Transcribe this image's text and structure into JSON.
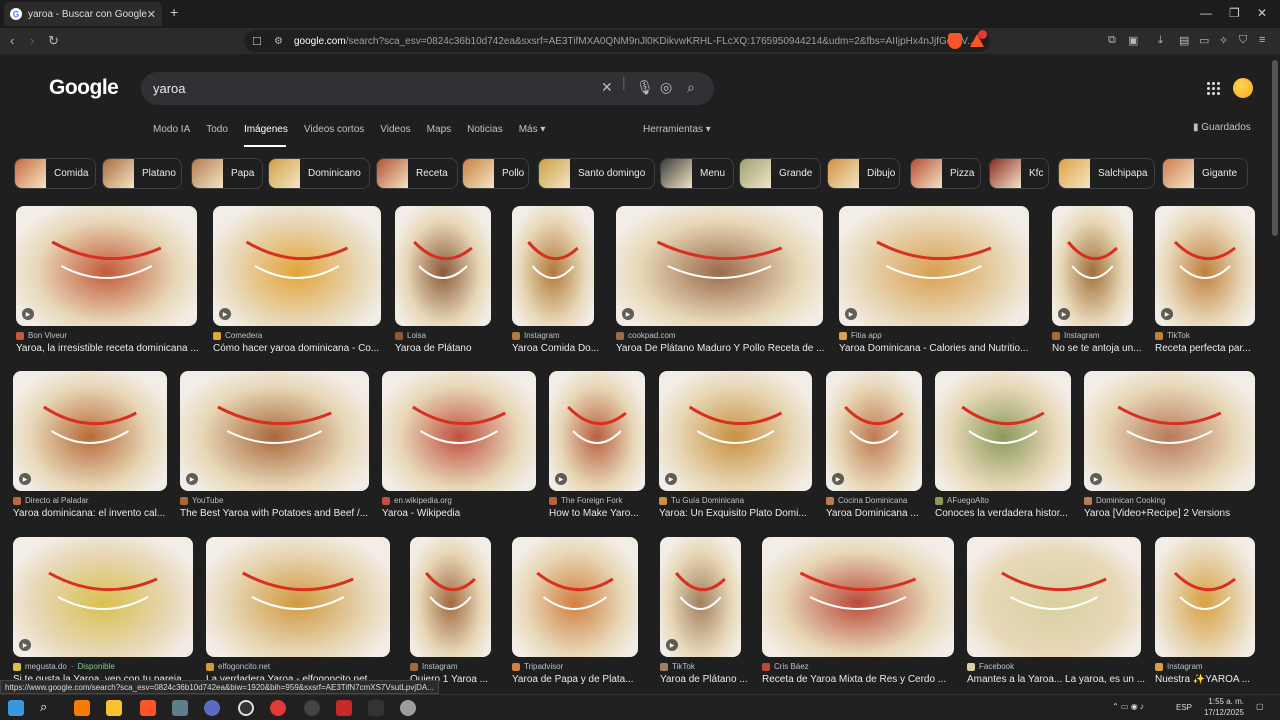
{
  "browser": {
    "tab_title": "yaroa - Buscar con Google",
    "url_host": "google.com",
    "url_path": "/search?sca_esv=0824c36b10d742ea&sxsrf=AE3TifMXA0QNM9nJl0KDikvwKRHL-FLcXQ:1765950944214&udm=2&fbs=AIIjpHx4nJjfGojPV...",
    "status_url": "https://www.google.com/search?sca_esv=0824c36b10d742ea&biw=1920&bih=959&sxsrf=AE3TifN7cmXS7VsutLpvjDA..."
  },
  "search": {
    "query": "yaroa",
    "logo": "Google"
  },
  "nav_tabs": [
    "Modo IA",
    "Todo",
    "Imágenes",
    "Videos cortos",
    "Videos",
    "Maps",
    "Noticias",
    "Más ▾"
  ],
  "tools_label": "Herramientas ▾",
  "saved_label": "Guardados",
  "chips": [
    "Comida",
    "Platano",
    "Papa",
    "Dominicano",
    "Receta",
    "Pollo",
    "Santo domingo",
    "Menu",
    "Grande",
    "Dibujo",
    "Pizza",
    "Kfc",
    "Salchipapa",
    "Gigante"
  ],
  "results_row1": [
    {
      "source": "Bon Viveur",
      "title": "Yaroa, la irresistible receta dominicana ...",
      "color": "#c25a3a"
    },
    {
      "source": "Comedera",
      "title": "Cómo hacer yaroa dominicana - Co...",
      "color": "#e3a43a"
    },
    {
      "source": "Loisa",
      "title": "Yaroa de Plátano",
      "color": "#8a5a3a"
    },
    {
      "source": "Instagram",
      "title": "Yaroa Comida Do...",
      "color": "#b07a3a"
    },
    {
      "source": "cookpad.com",
      "title": "Yaroa De Plátano Maduro Y Pollo Receta de ...",
      "color": "#9a6a4a"
    },
    {
      "source": "Fitia app",
      "title": "Yaroa Dominicana - Calories and Nutritio...",
      "color": "#d9a050"
    },
    {
      "source": "Instagram",
      "title": "No se te antoja un...",
      "color": "#a0703a"
    },
    {
      "source": "TikTok",
      "title": "Receta perfecta par...",
      "color": "#c08040"
    }
  ],
  "results_row2": [
    {
      "source": "Directo al Paladar",
      "title": "Yaroa dominicana: el invento cal...",
      "color": "#b86a3a"
    },
    {
      "source": "YouTube",
      "title": "The Best Yaroa with Potatoes and Beef /...",
      "color": "#a8683a"
    },
    {
      "source": "en.wikipedia.org",
      "title": "Yaroa - Wikipedia",
      "color": "#c05040"
    },
    {
      "source": "The Foreign Fork",
      "title": "How to Make Yaro...",
      "color": "#b86040"
    },
    {
      "source": "Tu Guía Dominicana",
      "title": "Yaroa: Un Exquisito Plato Domi...",
      "color": "#c89040"
    },
    {
      "source": "Cocina Dominicana",
      "title": "Yaroa Dominicana ...",
      "color": "#c07a50"
    },
    {
      "source": "AFuegoAlto",
      "title": "Conoces la verdadera histor...",
      "color": "#8a9a5a"
    },
    {
      "source": "Dominican Cooking",
      "title": "Yaroa [Video+Recipe] 2 Versions",
      "color": "#b87a5a"
    }
  ],
  "results_row3": [
    {
      "source": "megusta.do",
      "extra": "Disponible",
      "title": "Si te gusta la Yaroa, ven con tu pareja ...",
      "color": "#d8c050"
    },
    {
      "source": "elfogoncito.net",
      "title": "La verdadera Yaroa - elfogoncito.net",
      "color": "#d09a40"
    },
    {
      "source": "Instagram",
      "title": "Quiero 1 Yaroa ...",
      "color": "#a06a40"
    },
    {
      "source": "Tripadvisor",
      "title": "Yaroa de Papa y de Plata...",
      "color": "#d08040"
    },
    {
      "source": "TikTok",
      "title": "Yaroa de Plátano ...",
      "color": "#a08060"
    },
    {
      "source": "Cris Báez",
      "title": "Receta de Yaroa Mixta de Res y Cerdo ...",
      "color": "#b84a3a"
    },
    {
      "source": "Facebook",
      "title": "Amantes a la Yaroa... La yaroa, es un ...",
      "color": "#d8d0a0"
    },
    {
      "source": "Instagram",
      "title": "Nuestra ✨YAROA ...",
      "color": "#d8a040"
    }
  ],
  "taskbar": {
    "time": "1:55 a. m.",
    "date": "17/12/2025",
    "lang": "ESP"
  }
}
